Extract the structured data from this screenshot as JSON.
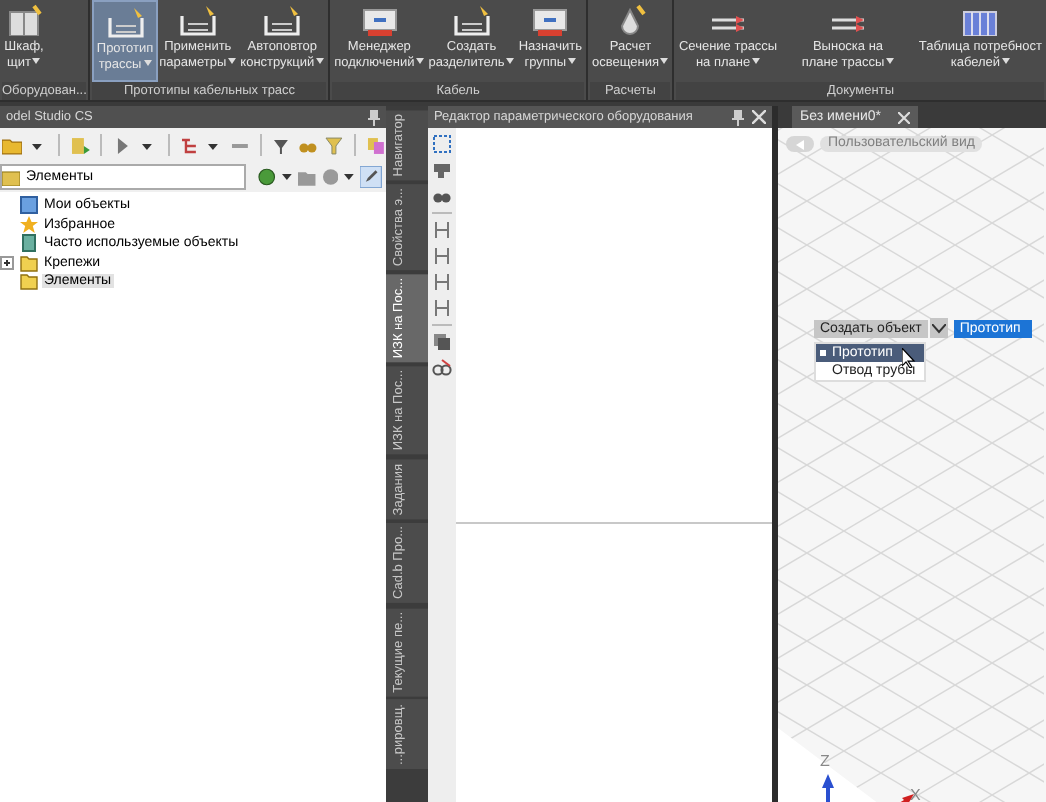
{
  "ribbon": {
    "groups": [
      {
        "label": "Оборудован...",
        "buttons": [
          {
            "lines": [
              "Шкаф,",
              "щит"
            ],
            "selected": false
          }
        ]
      },
      {
        "label": "Прототипы кабельных трасс",
        "buttons": [
          {
            "lines": [
              "Прототип",
              "трассы"
            ],
            "selected": true
          },
          {
            "lines": [
              "Применить",
              "параметры"
            ],
            "selected": false
          },
          {
            "lines": [
              "Автоповтор",
              "конструкций"
            ],
            "selected": false
          }
        ]
      },
      {
        "label": "Кабель",
        "buttons": [
          {
            "lines": [
              "Менеджер",
              "подключений"
            ],
            "selected": false
          },
          {
            "lines": [
              "Создать",
              "разделитель"
            ],
            "selected": false
          },
          {
            "lines": [
              "Назначить",
              "группы"
            ],
            "selected": false
          }
        ]
      },
      {
        "label": "Расчеты",
        "buttons": [
          {
            "lines": [
              "Расчет",
              "освещения"
            ],
            "selected": false
          }
        ]
      },
      {
        "label": "Документы",
        "buttons": [
          {
            "lines": [
              "Сечение трассы",
              "на плане"
            ],
            "selected": false
          },
          {
            "lines": [
              "Выноска на",
              "плане трассы"
            ],
            "selected": false
          },
          {
            "lines": [
              "Таблица потребност",
              "кабелей"
            ],
            "selected": false
          }
        ]
      }
    ]
  },
  "left_panel": {
    "title": "odel Studio CS",
    "search": {
      "value": "Элементы"
    },
    "tree": [
      {
        "label": "Мои объекты",
        "expandable": false,
        "selected": false
      },
      {
        "label": "Избранное",
        "expandable": false,
        "selected": false
      },
      {
        "label": "Часто используемые объекты",
        "expandable": false,
        "selected": false
      },
      {
        "label": "Крепежи",
        "expandable": true,
        "selected": false
      },
      {
        "label": "Элементы",
        "expandable": false,
        "selected": true
      }
    ]
  },
  "side_tabs": [
    {
      "label": "Навигатор",
      "selected": false
    },
    {
      "label": "Свойства э...",
      "selected": false
    },
    {
      "label": "ИЗК на Пос...",
      "selected": true
    },
    {
      "label": "ИЗК на Пос...",
      "selected": false
    },
    {
      "label": "Задания",
      "selected": false
    },
    {
      "label": "Cad.b Про...",
      "selected": false
    },
    {
      "label": "Текущие пе...",
      "selected": false
    },
    {
      "label": "...рировщ.",
      "selected": false
    }
  ],
  "editor_panel": {
    "title": "Редактор параметрического оборудования"
  },
  "viewport": {
    "tab": {
      "label": "Без имени0*"
    },
    "view_name": "Пользовательский вид",
    "create_object": {
      "label": "Создать объект",
      "value": "Прототип",
      "menu": [
        {
          "label": "Прототип",
          "selected": true
        },
        {
          "label": "Отвод трубы",
          "selected": false
        }
      ]
    },
    "axes": {
      "z": "Z",
      "x": "X"
    }
  }
}
